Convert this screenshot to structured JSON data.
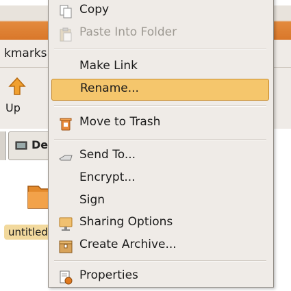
{
  "background_window": {
    "menubar_text": "kmarks",
    "up_button_label": "Up",
    "path_button_label": "De",
    "folder_label": "untitled"
  },
  "context_menu": {
    "items": [
      {
        "label": "Copy",
        "icon": "copy-icon",
        "enabled": true
      },
      {
        "label": "Paste Into Folder",
        "icon": "paste-icon",
        "enabled": false
      },
      {
        "label": "Make Link",
        "icon": "",
        "enabled": true
      },
      {
        "label": "Rename...",
        "icon": "",
        "enabled": true,
        "selected": true
      },
      {
        "label": "Move to Trash",
        "icon": "trash-icon",
        "enabled": true
      },
      {
        "label": "Send To...",
        "icon": "send-icon",
        "enabled": true
      },
      {
        "label": "Encrypt...",
        "icon": "",
        "enabled": true
      },
      {
        "label": "Sign",
        "icon": "",
        "enabled": true
      },
      {
        "label": "Sharing Options",
        "icon": "sharing-icon",
        "enabled": true
      },
      {
        "label": "Create Archive...",
        "icon": "archive-icon",
        "enabled": true
      },
      {
        "label": "Properties",
        "icon": "properties-icon",
        "enabled": true
      }
    ]
  },
  "colors": {
    "selection": "#f5c66c",
    "menu_background": "#efebe7",
    "titlebar_orange": "#d9772a"
  }
}
